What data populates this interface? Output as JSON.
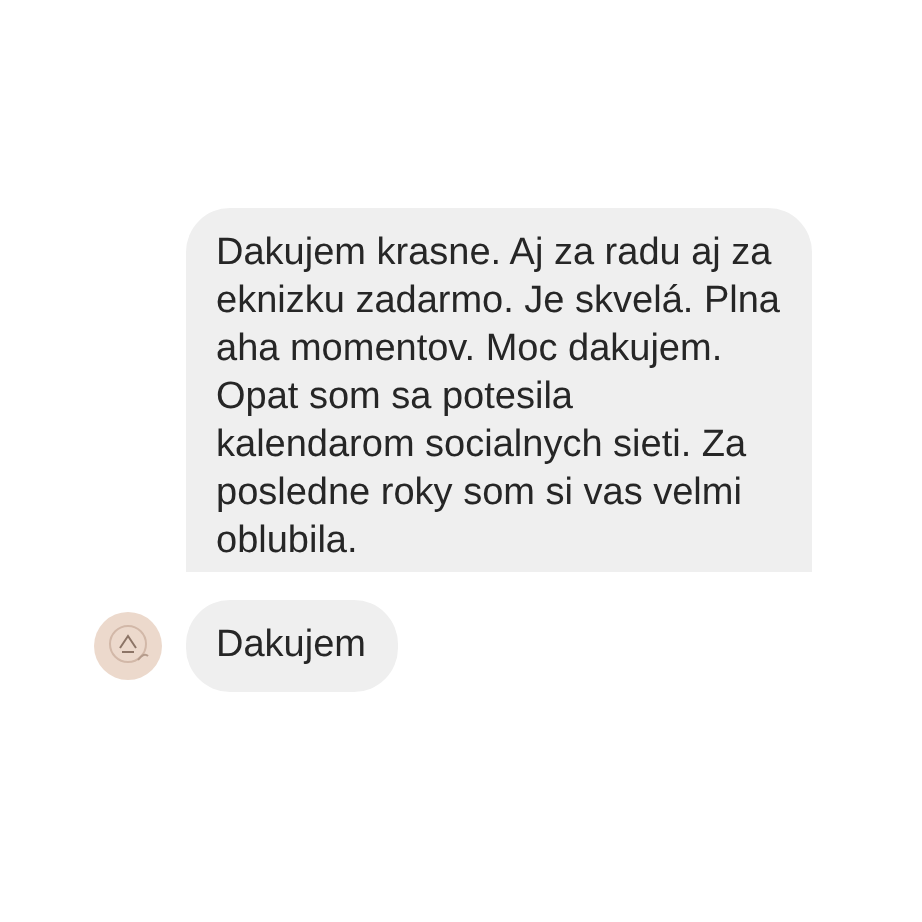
{
  "messages": [
    {
      "text": "Dakujem krasne. Aj za radu aj za eknizku zadarmo. Je skvelá. Plna aha momentov. Moc dakujem. Opat som sa potesila kalendarom socialnych sieti. Za posledne roky som si vas velmi oblubila.",
      "avatar": false
    },
    {
      "text": "Dakujem",
      "avatar": true
    }
  ]
}
